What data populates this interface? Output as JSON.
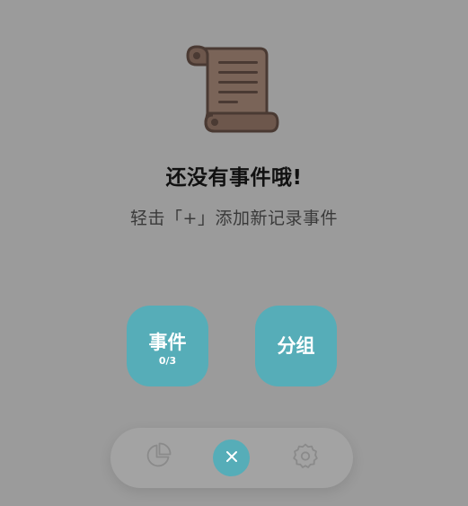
{
  "empty_state": {
    "icon": "scroll-icon",
    "title": "还没有事件哦!",
    "hint": "轻击「+」添加新记录事件"
  },
  "actions": {
    "events": {
      "label": "事件",
      "count": "0/3"
    },
    "groups": {
      "label": "分组"
    }
  },
  "bottom_nav": {
    "left_icon": "pie-chart-icon",
    "center_icon": "close-icon",
    "right_icon": "gear-icon"
  },
  "colors": {
    "background": "#9b9b9b",
    "accent": "#56adb8",
    "scroll": "#7a6458"
  }
}
